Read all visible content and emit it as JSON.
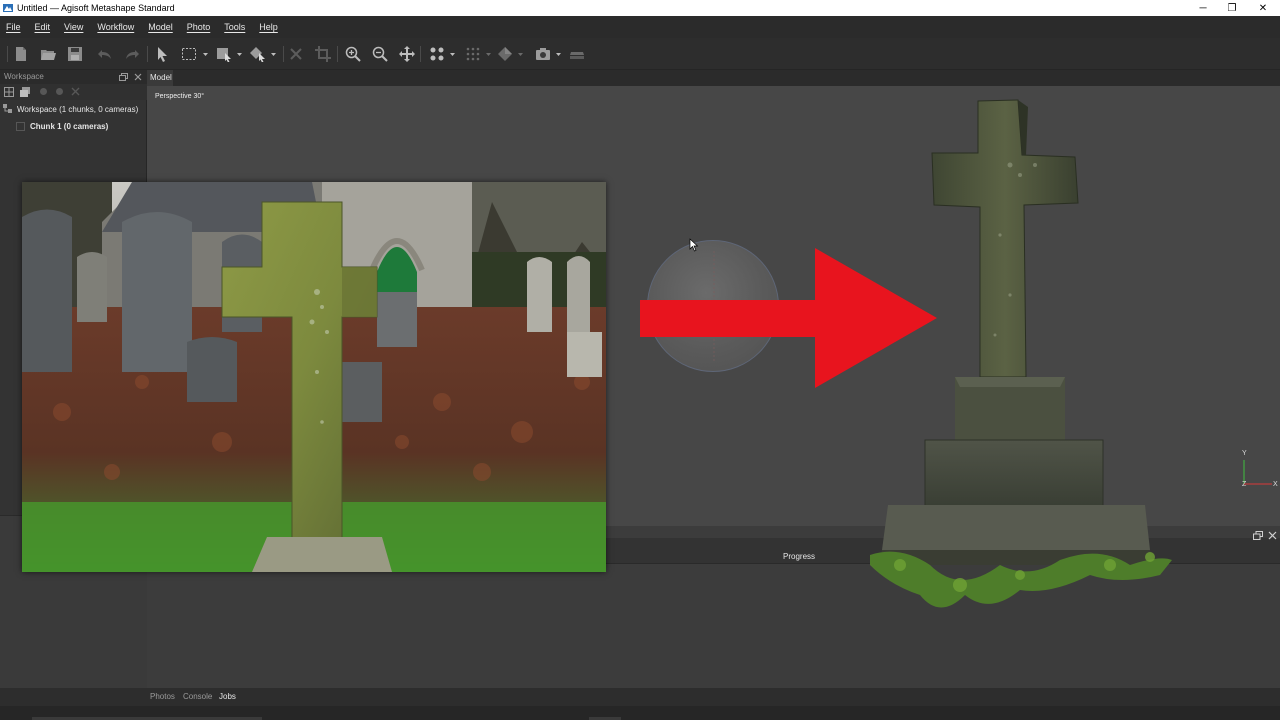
{
  "window": {
    "title": "Untitled — Agisoft Metashape Standard",
    "controls": {
      "minimize": "─",
      "restore": "❐",
      "close": "✕"
    }
  },
  "menu": [
    "File",
    "Edit",
    "View",
    "Workflow",
    "Model",
    "Photo",
    "Tools",
    "Help"
  ],
  "toolbar": {
    "icons": [
      "new-document-icon",
      "open-folder-icon",
      "save-icon",
      "undo-icon",
      "redo-icon",
      "navigation-arrow-icon",
      "rectangle-selection-icon",
      "model-selection-icon",
      "shape-selection-icon",
      "delete-icon",
      "crop-icon",
      "zoom-in-icon",
      "zoom-out-icon",
      "move-object-icon",
      "point-cloud-icon",
      "dense-cloud-icon",
      "shaded-model-icon",
      "camera-icon",
      "show-photos-icon"
    ]
  },
  "workspace": {
    "panel_title": "Workspace",
    "root_label": "Workspace (1 chunks, 0 cameras)",
    "chunk_label": "Chunk 1 (0 cameras)"
  },
  "model_view": {
    "tab_label": "Model",
    "perspective_label": "Perspective 30°",
    "axes": {
      "x": "X",
      "y": "Y",
      "z": "Z"
    }
  },
  "jobs_panel": {
    "columns": [
      "Progress"
    ]
  },
  "bottom_tabs": [
    "Photos",
    "Console",
    "Jobs"
  ],
  "overlay": {
    "arrow_color": "#e8141e"
  }
}
